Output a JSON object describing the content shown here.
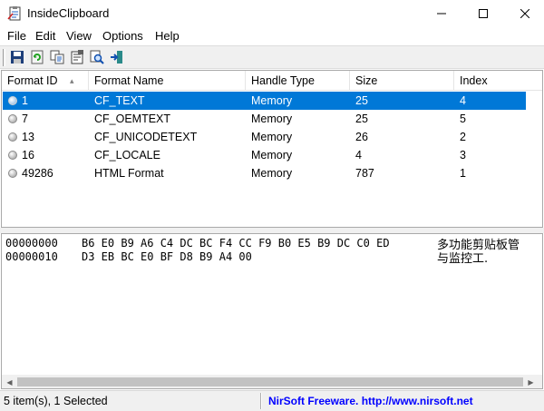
{
  "window": {
    "title": "InsideClipboard"
  },
  "menu": [
    "File",
    "Edit",
    "View",
    "Options",
    "Help"
  ],
  "toolbar": {
    "icons": [
      "save-icon",
      "refresh-icon",
      "copy-icon",
      "properties-icon",
      "find-icon",
      "exit-icon"
    ]
  },
  "list": {
    "columns": [
      "Format ID",
      "Format Name",
      "Handle Type",
      "Size",
      "Index"
    ],
    "rows": [
      {
        "id": "1",
        "name": "CF_TEXT",
        "handle": "Memory",
        "size": "25",
        "index": "4",
        "selected": true
      },
      {
        "id": "7",
        "name": "CF_OEMTEXT",
        "handle": "Memory",
        "size": "25",
        "index": "5"
      },
      {
        "id": "13",
        "name": "CF_UNICODETEXT",
        "handle": "Memory",
        "size": "26",
        "index": "2"
      },
      {
        "id": "16",
        "name": "CF_LOCALE",
        "handle": "Memory",
        "size": "4",
        "index": "3"
      },
      {
        "id": "49286",
        "name": "HTML Format",
        "handle": "Memory",
        "size": "787",
        "index": "1"
      }
    ]
  },
  "hex": {
    "lines": [
      {
        "offset": "00000000",
        "bytes": "B6 E0 B9 A6 C4 DC BC F4 CC F9 B0 E5 B9 DC C0 ED",
        "text": "多功能剪贴板管"
      },
      {
        "offset": "00000010",
        "bytes": "D3 EB BC E0 BF D8 B9 A4 00",
        "text": "与监控工."
      }
    ]
  },
  "status": {
    "items": "5 item(s), 1 Selected",
    "link": "NirSoft Freeware.  http://www.nirsoft.net"
  },
  "colors": {
    "selection": "#0078d7",
    "link": "#0000ff"
  }
}
